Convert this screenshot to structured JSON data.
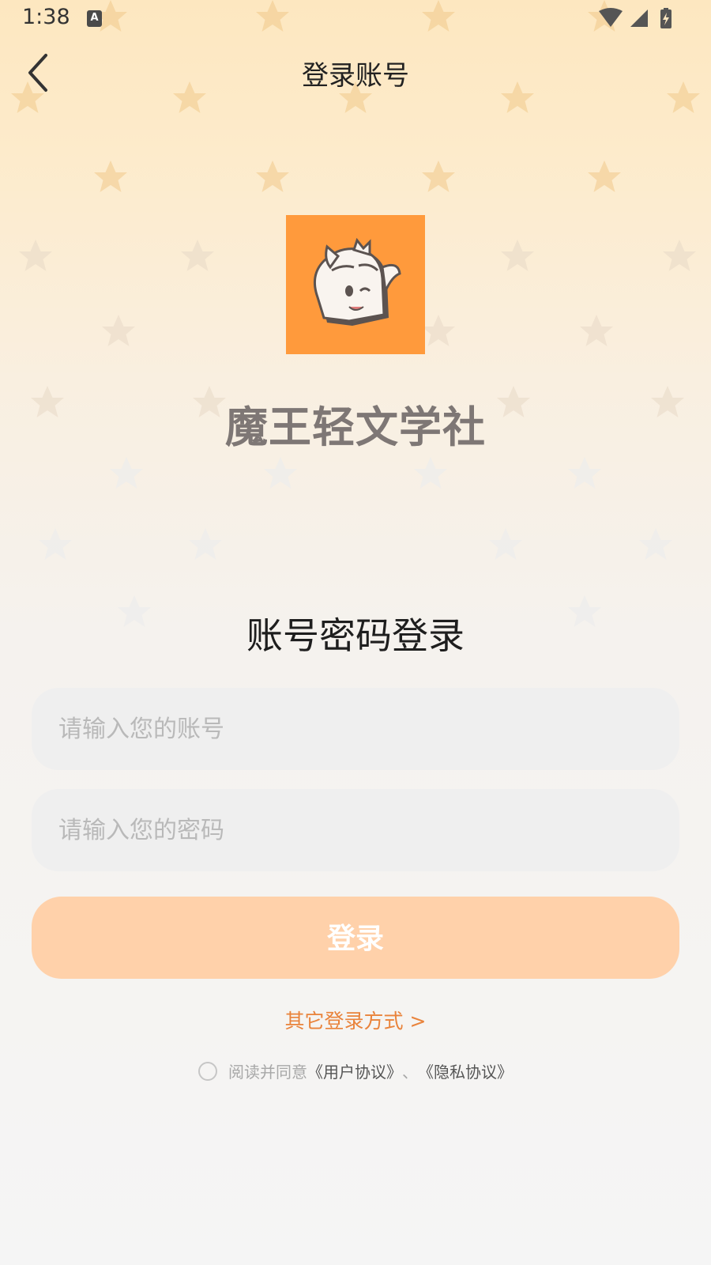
{
  "status_bar": {
    "time": "1:38",
    "notification_icon": "a-icon",
    "right_icons": [
      "wifi-icon",
      "signal-icon",
      "battery-charging-icon"
    ]
  },
  "header": {
    "back_icon": "chevron-left-icon",
    "title": "登录账号"
  },
  "brand": {
    "logo_icon": "mascot-logo",
    "name": "魔王轻文学社"
  },
  "form": {
    "title": "账号密码登录",
    "account_placeholder": "请输入您的账号",
    "password_placeholder": "请输入您的密码",
    "login_label": "登录",
    "other_login": "其它登录方式 >"
  },
  "agreement": {
    "prefix": "阅读并同意",
    "user_agreement": "《用户协议》",
    "separator": "、",
    "privacy_policy": "《隐私协议》"
  },
  "colors": {
    "accent": "#e9833b",
    "button_bg": "#ffd1aa",
    "logo_bg": "#ff9a3c"
  }
}
